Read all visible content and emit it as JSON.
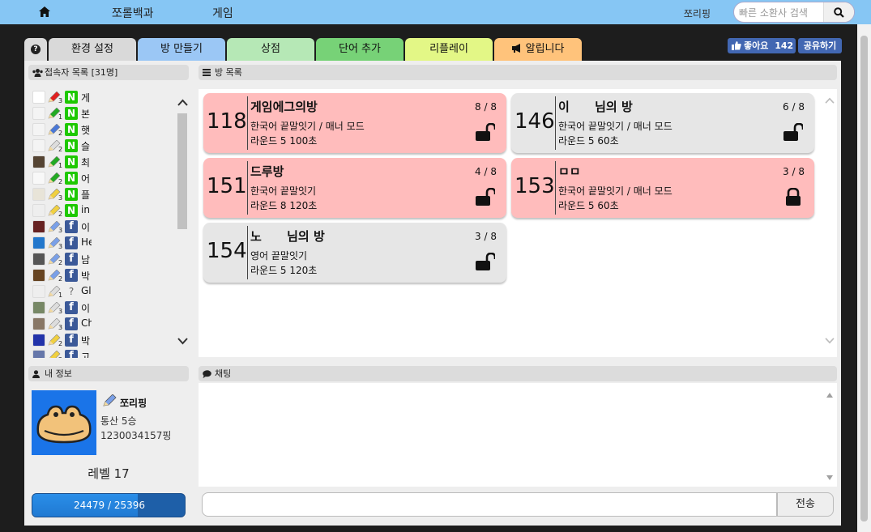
{
  "topbar": {
    "nav": [
      "쪼롤백과",
      "게임"
    ],
    "nickname": "쪼리핑",
    "search_placeholder": "빠른 소환사 검색"
  },
  "tabs": [
    {
      "label": "환경 설정",
      "color": "#d9d9d9"
    },
    {
      "label": "방 만들기",
      "color": "#9bc7f5"
    },
    {
      "label": "상점",
      "color": "#b6e8b6"
    },
    {
      "label": "단어 추가",
      "color": "#77d277"
    },
    {
      "label": "리플레이",
      "color": "#e3f786"
    },
    {
      "label": "알립니다",
      "color": "#ffc37b"
    }
  ],
  "social": {
    "like_label": "좋아요",
    "like_count": "142",
    "share_label": "공유하기"
  },
  "userlist": {
    "title": "접속자 목록 [31명]",
    "users": [
      {
        "name": "게",
        "level": "3",
        "login": "naver",
        "badge": "N",
        "pencil": "#e02020",
        "avatar": "#ffffff"
      },
      {
        "name": "본",
        "level": "1",
        "login": "naver",
        "badge": "N",
        "pencil": "#22aa22",
        "avatar": "#f4f4f4"
      },
      {
        "name": "햇",
        "level": "2",
        "login": "naver",
        "badge": "N",
        "pencil": "#4a78d8",
        "avatar": "#f4f4f4"
      },
      {
        "name": "슬",
        "level": "2",
        "login": "naver",
        "badge": "N",
        "pencil": "#dddddd",
        "avatar": "#f4f4f4"
      },
      {
        "name": "최",
        "level": "1",
        "login": "naver",
        "badge": "N",
        "pencil": "#22aa22",
        "avatar": "#554433"
      },
      {
        "name": "어",
        "level": "2",
        "login": "naver",
        "badge": "N",
        "pencil": "#22aa22",
        "avatar": "#f8f8f8"
      },
      {
        "name": "플",
        "level": "3",
        "login": "naver",
        "badge": "N",
        "pencil": "#f0d040",
        "avatar": "#e8e4d8"
      },
      {
        "name": "in",
        "level": "2",
        "login": "naver",
        "badge": "N",
        "pencil": "#f0d040",
        "avatar": "#eeeeee"
      },
      {
        "name": "이",
        "level": "3",
        "login": "facebook",
        "badge": "f",
        "pencil": "#7aa0e8",
        "avatar": "#662222"
      },
      {
        "name": "He",
        "level": "3",
        "login": "facebook",
        "badge": "f",
        "pencil": "#7aa0e8",
        "avatar": "#2277cc"
      },
      {
        "name": "남",
        "level": "2",
        "login": "facebook",
        "badge": "f",
        "pencil": "#7aa0e8",
        "avatar": "#555555"
      },
      {
        "name": "박",
        "level": "2",
        "login": "facebook",
        "badge": "f",
        "pencil": "#7aa0e8",
        "avatar": "#664422"
      },
      {
        "name": "Gl",
        "level": "1",
        "login": "guest",
        "badge": "?",
        "pencil": "#dddddd",
        "avatar": "#eeeeee"
      },
      {
        "name": "이",
        "level": "3",
        "login": "facebook",
        "badge": "f",
        "pencil": "#dddddd",
        "avatar": "#778866"
      },
      {
        "name": "Ch",
        "level": "3",
        "login": "facebook",
        "badge": "f",
        "pencil": "#dddddd",
        "avatar": "#887766"
      },
      {
        "name": "박",
        "level": "2",
        "login": "facebook",
        "badge": "f",
        "pencil": "#f0d040",
        "avatar": "#2233aa"
      },
      {
        "name": "고",
        "level": "2",
        "login": "facebook",
        "badge": "f",
        "pencil": "#f0d040",
        "avatar": "#6677aa"
      }
    ]
  },
  "roomlist": {
    "title": "방 목록",
    "rooms": [
      {
        "id": "118",
        "title": "게임에그의방",
        "mode": "한국어 끝말잇기 / 매너 모드",
        "rule": "라운드 5   100초",
        "players": "8 / 8",
        "status": "full",
        "locked": false
      },
      {
        "id": "146",
        "title": "이      님의 방",
        "mode": "한국어 끝말잇기 / 매너 모드",
        "rule": "라운드 5   60초",
        "players": "6 / 8",
        "status": "open",
        "locked": false
      },
      {
        "id": "151",
        "title": "드루방",
        "mode": "한국어 끝말잇기",
        "rule": "라운드 8   120초",
        "players": "4 / 8",
        "status": "full",
        "locked": false
      },
      {
        "id": "153",
        "title": "ㅁㅁ",
        "mode": "한국어 끝말잇기 / 매너 모드",
        "rule": "라운드 5   60초",
        "players": "3 / 8",
        "status": "full",
        "locked": true
      },
      {
        "id": "154",
        "title": "노      님의 방",
        "mode": "영어 끝말잇기",
        "rule": "라운드 5   120초",
        "players": "3 / 8",
        "status": "open",
        "locked": false
      }
    ]
  },
  "myinfo": {
    "title": "내 정보",
    "nickname": "쪼리핑",
    "record": "통산 5승",
    "ping": "1230034157핑",
    "level": "레벨 17",
    "exp_text": "24479 / 25396",
    "exp_current": 24479,
    "exp_max": 25396
  },
  "chat": {
    "title": "채팅",
    "input_value": "",
    "send_label": "전송"
  }
}
